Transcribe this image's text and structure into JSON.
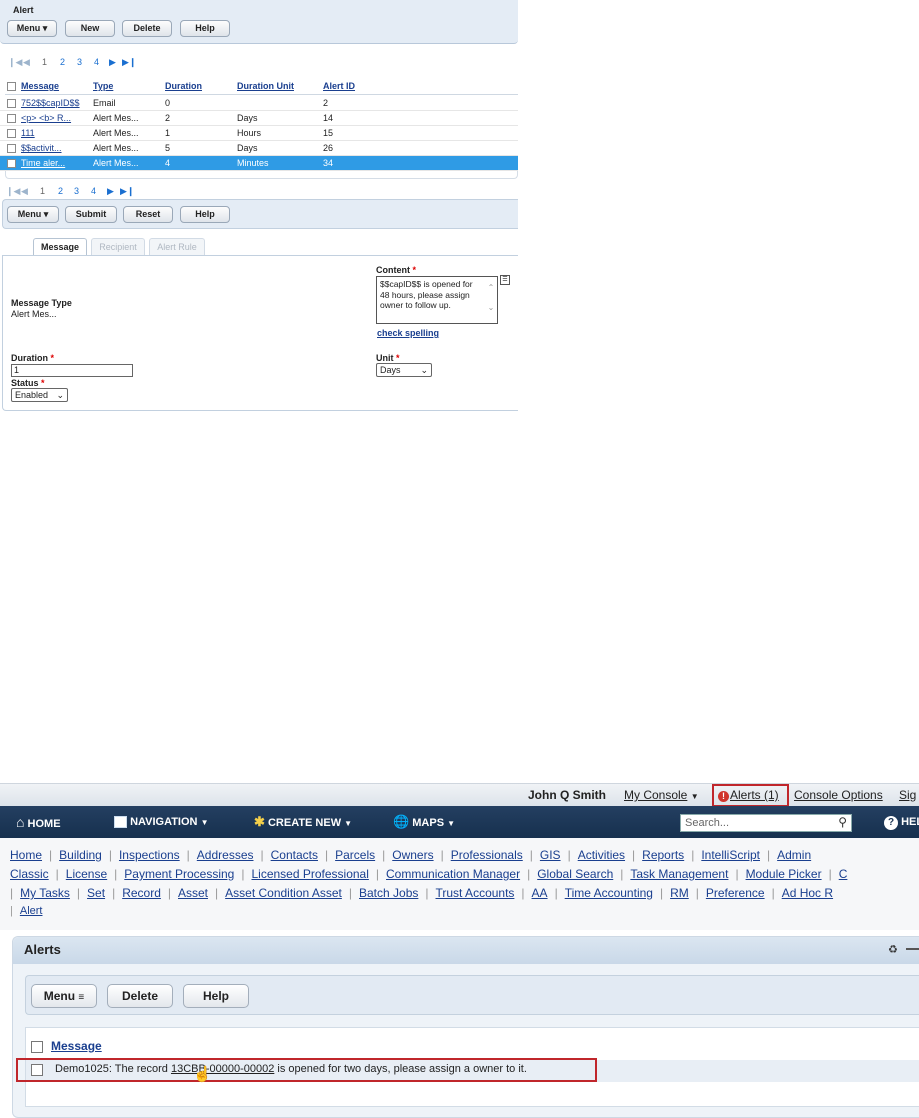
{
  "alert_panel": {
    "title": "Alert",
    "toolbar": {
      "menu": "Menu",
      "new": "New",
      "delete": "Delete",
      "help": "Help"
    },
    "pager": {
      "pages": [
        "1",
        "2",
        "3",
        "4"
      ]
    },
    "columns": [
      "Message",
      "Type",
      "Duration",
      "Duration Unit",
      "Alert ID"
    ],
    "rows": [
      {
        "message": "752$$capID$$",
        "type": "Email",
        "duration": "0",
        "unit": "",
        "id": "2"
      },
      {
        "message": "<p> <b> R...",
        "type": "Alert Mes...",
        "duration": "2",
        "unit": "Days",
        "id": "14"
      },
      {
        "message": "111",
        "type": "Alert Mes...",
        "duration": "1",
        "unit": "Hours",
        "id": "15"
      },
      {
        "message": "$$activit...",
        "type": "Alert Mes...",
        "duration": "5",
        "unit": "Days",
        "id": "26"
      },
      {
        "message": "Time aler...",
        "type": "Alert Mes...",
        "duration": "4",
        "unit": "Minutes",
        "id": "34"
      }
    ],
    "selected_row": 4
  },
  "detail_panel": {
    "toolbar": {
      "menu": "Menu",
      "submit": "Submit",
      "reset": "Reset",
      "help": "Help"
    },
    "tabs": [
      "Message",
      "Recipient",
      "Alert Rule"
    ],
    "message_type_label": "Message Type",
    "message_type_value": "Alert Mes...",
    "content_label": "Content",
    "content_value": "$$capID$$ is opened for 48 hours, please assign owner to follow up.",
    "check_spelling": "check spelling",
    "duration_label": "Duration",
    "duration_value": "1",
    "unit_label": "Unit",
    "unit_value": "Days",
    "status_label": "Status",
    "status_value": "Enabled",
    "required": "*"
  },
  "header": {
    "user": "John Q Smith",
    "my_console": "My Console",
    "alerts": "Alerts (1)",
    "console_options": "Console Options",
    "sign": "Sig"
  },
  "navbar": {
    "home": "HOME",
    "navigation": "NAVIGATION",
    "create_new": "CREATE NEW",
    "maps": "MAPS",
    "search_placeholder": "Search...",
    "help": "HEL"
  },
  "menu_rows": [
    [
      "Home",
      "Building",
      "Inspections",
      "Addresses",
      "Contacts",
      "Parcels",
      "Owners",
      "Professionals",
      "GIS",
      "Activities",
      "Reports",
      "IntelliScript",
      "Admin"
    ],
    [
      "Classic",
      "License",
      "Payment Processing",
      "Licensed Professional",
      "Communication Manager",
      "Global Search",
      "Task Management",
      "Module Picker",
      "C"
    ],
    [
      "My Tasks",
      "Set",
      "Record",
      "Asset",
      "Asset Condition Asset",
      "Batch Jobs",
      "Trust Accounts",
      "AA",
      "Time Accounting",
      "RM",
      "Preference",
      "Ad Hoc R"
    ],
    [
      "Alert"
    ]
  ],
  "alerts_portlet": {
    "title": "Alerts",
    "toolbar": {
      "menu": "Menu",
      "delete": "Delete",
      "help": "Help"
    },
    "column": "Message",
    "row_prefix": "Demo1025: The record ",
    "row_link": "13CBB-00000-00002",
    "row_suffix": " is opened for two days, please assign a owner to it."
  },
  "colors": {
    "accent_blue": "#2f9be5",
    "navbar": "#1c3554",
    "highlight_border": "#c0262b",
    "panel_bg": "#e9f0f8"
  }
}
